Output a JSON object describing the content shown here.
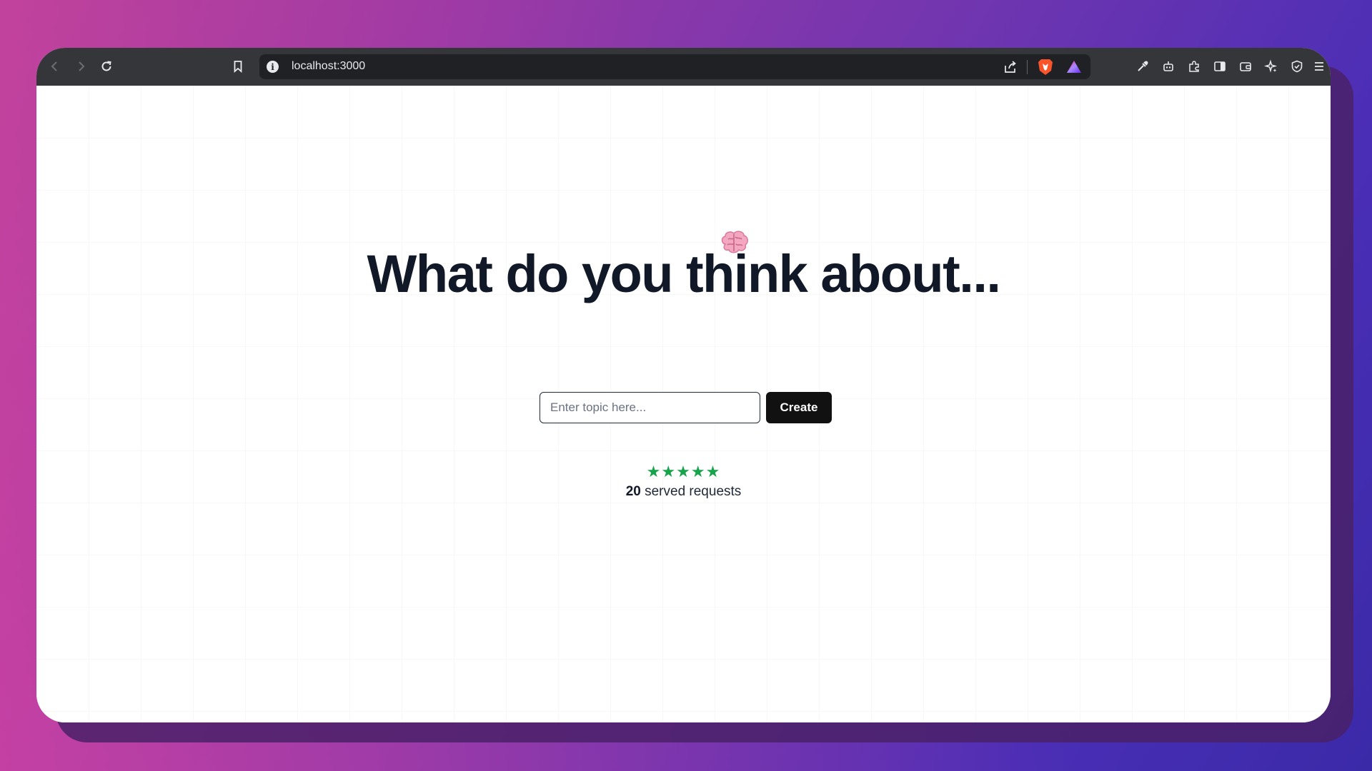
{
  "browser": {
    "url": "localhost:3000",
    "toolbar_icons": [
      "back-icon",
      "forward-icon",
      "reload-icon",
      "bookmark-icon",
      "site-info-icon",
      "share-icon",
      "brave-shields-icon",
      "brave-rewards-icon",
      "eyedropper-icon",
      "leo-ai-icon",
      "extensions-icon",
      "sidebar-icon",
      "wallet-icon",
      "customize-icon",
      "vpn-icon",
      "menu-icon"
    ]
  },
  "page": {
    "headline": "What do you think about...",
    "decoration_icon": "brain-icon",
    "input_placeholder": "Enter topic here...",
    "input_value": "",
    "create_label": "Create",
    "rating": {
      "stars": 5,
      "max": 5,
      "color": "#16a34a"
    },
    "served_count": "20",
    "served_label": "served requests"
  },
  "colors": {
    "toolbar": "#35363a",
    "addressbar": "#202124",
    "headline": "#111827",
    "button": "#111111"
  }
}
